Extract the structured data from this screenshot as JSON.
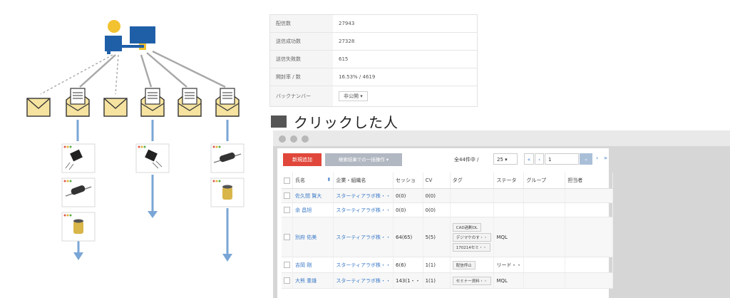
{
  "illustration": {
    "icons": [
      "person-at-computer-icon",
      "envelope-icon",
      "open-envelope-icon",
      "product-transistor-icon",
      "product-capacitor-icon"
    ],
    "colors": {
      "envelope": "#f6e3a0",
      "line": "#aaaaaa",
      "arrow": "#7aa6d6",
      "monitor": "#1f5fa8"
    }
  },
  "stats": {
    "rows": [
      {
        "label": "配信数",
        "value": "27943"
      },
      {
        "label": "送信成功数",
        "value": "27328"
      },
      {
        "label": "送信失敗数",
        "value": "615"
      },
      {
        "label": "開封率 / 数",
        "value": "16.53% / 4619"
      },
      {
        "label": "バックナンバー",
        "value": "非公開 ▾"
      }
    ]
  },
  "heading": {
    "text": "クリックした人"
  },
  "app": {
    "toolbar": {
      "new_label": "新規追加",
      "bulk_label": "検索結果での一括操作 ▾"
    },
    "pager": {
      "total": "全44件中 /",
      "per_page": "25 ▾",
      "first": "«",
      "prev": "‹",
      "page": "1",
      "go": "⌄",
      "next": "›",
      "last": "»"
    },
    "columns": [
      "氏名",
      "企業・組織名",
      "セッショ",
      "CV",
      "タグ",
      "ステータ",
      "グループ",
      "担当者"
    ],
    "rows": [
      {
        "name": "佐久間 賢大",
        "company": "スターティアラボ株・・",
        "session": "0(0)",
        "cv": "0(0)",
        "tags": [],
        "status": "",
        "group": "",
        "owner": ""
      },
      {
        "name": "余 昌旭",
        "company": "スターティアラボ株・・",
        "session": "0(0)",
        "cv": "0(0)",
        "tags": [],
        "status": "",
        "group": "",
        "owner": ""
      },
      {
        "name": "別府 佑美",
        "company": "スターティアラボ株・・",
        "session": "64(65)",
        "cv": "5(5)",
        "tags": [
          "CAD過剰OL",
          "デジマケのす・・",
          "170214セミ・・"
        ],
        "status": "MQL",
        "group": "",
        "owner": ""
      },
      {
        "name": "吉岡 剛",
        "company": "スターティアラボ株・・",
        "session": "6(6)",
        "cv": "1(1)",
        "tags": [
          "配信停止"
        ],
        "status": "リード・・",
        "group": "",
        "owner": ""
      },
      {
        "name": "大熊 重雄",
        "company": "スターティアラボ株・・",
        "session": "143(1・・",
        "cv": "1(1)",
        "tags": [
          "セミナー資料・・"
        ],
        "status": "MQL",
        "group": "",
        "owner": ""
      }
    ]
  }
}
